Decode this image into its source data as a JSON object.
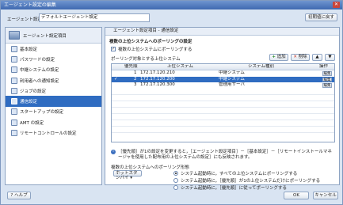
{
  "window": {
    "title": "エージェント設定の編集"
  },
  "agent_name": {
    "label": "エージェント設定名：",
    "value": "デフォルトエージェント設定"
  },
  "initial_button": "初期値に戻す",
  "sidebar": {
    "header": "エージェント設定項目",
    "items": [
      {
        "label": "基本設定"
      },
      {
        "label": "パスワードの設定"
      },
      {
        "label": "中継システムの設定"
      },
      {
        "label": "利用者への通知設定"
      },
      {
        "label": "ジョブの設定"
      },
      {
        "label": "通信設定"
      },
      {
        "label": "スタートアップの設定"
      },
      {
        "label": "AMT の設定"
      },
      {
        "label": "リモートコントロールの設定"
      }
    ],
    "selected_index": 5
  },
  "main": {
    "breadcrumb": "エージェント設定項目 - 通信設定",
    "section_title": "複数の上位システムへのポーリングの設定",
    "poll_checkbox": {
      "label": "複数の上位システムにポーリングする",
      "checked": true
    },
    "list_label": "ポーリング対象とする上位システム",
    "toolbar": {
      "add": "追加",
      "delete": "削除",
      "up": "▲",
      "down": "▼"
    },
    "table": {
      "headers": [
        "優先順",
        "上位システム",
        "システム種別",
        "操作"
      ],
      "rows": [
        {
          "priority": "1",
          "host": "172.17.120.210",
          "type": "中継システム",
          "action": "編集",
          "checked": false
        },
        {
          "priority": "2",
          "host": "172.17.120.200",
          "type": "中継システム",
          "action": "編集",
          "checked": true
        },
        {
          "priority": "3",
          "host": "172.17.120.300",
          "type": "管理用サーバ",
          "action": "編集",
          "checked": false
        }
      ],
      "selected_row": 1
    },
    "info_text": "［優先順］が1の設定を変更すると，［エージェント設定項目］－［基本設定］－［リモートインストールマネージャを使用した配布用の上位システムの設定］にも反映されます。",
    "policy_label": "複数の上位システムへのポーリング形態",
    "dropdown_value": "ホットスタンバイ",
    "radios": [
      {
        "label": "システム起動時に，すべての上位システムにポーリングする",
        "selected": true
      },
      {
        "label": "システム起動時に，［優先順］が1の上位システムだけにポーリングする",
        "selected": false
      },
      {
        "label": "システム起動時に，［優先順］に従ってポーリングする",
        "selected": false
      }
    ]
  },
  "footer": {
    "help": "ヘルプ",
    "ok": "OK",
    "cancel": "キャンセル"
  }
}
